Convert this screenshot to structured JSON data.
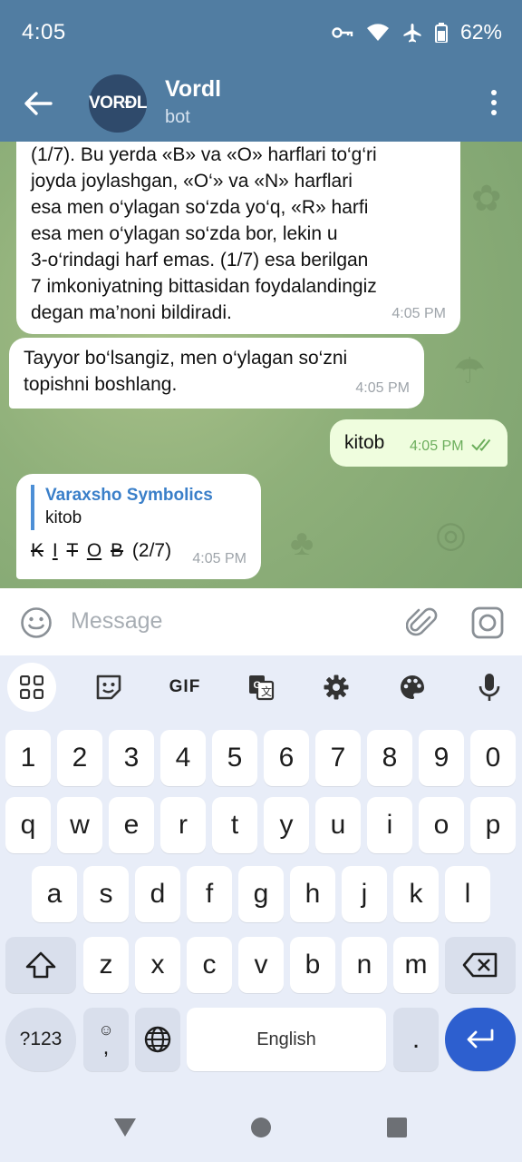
{
  "status_bar": {
    "time": "4:05",
    "battery": "62%"
  },
  "header": {
    "avatar_text": "VORÐL",
    "title": "Vordl",
    "subtitle": "bot"
  },
  "messages": {
    "m1": {
      "lines": [
        "(1/7). Bu yerda «B» va «O» harflari to‘g‘ri",
        "joyda joylashgan, «O‘» va «N» harflari",
        "esa men o‘ylagan so‘zda yo‘q, «R» harfi",
        "esa men o‘ylagan so‘zda bor, lekin u",
        "3-o‘rindagi harf emas. (1/7) esa berilgan",
        "7 imkoniyatning bittasidan foydalandingiz",
        "degan ma’noni bildiradi."
      ],
      "time": "4:05 PM"
    },
    "m2": {
      "lines": [
        "Tayyor bo‘lsangiz, men o‘ylagan so‘zni",
        "topishni boshlang."
      ],
      "time": "4:05 PM"
    },
    "m3": {
      "text": "kitob",
      "time": "4:05 PM"
    },
    "m4": {
      "reply_name": "Varaxsho Symbolics",
      "reply_text": "kitob",
      "letters": [
        "K",
        "I",
        "T",
        "O",
        "B"
      ],
      "count": "(2/7)",
      "time": "4:05 PM"
    }
  },
  "input": {
    "placeholder": "Message"
  },
  "keyboard": {
    "row_numbers": [
      "1",
      "2",
      "3",
      "4",
      "5",
      "6",
      "7",
      "8",
      "9",
      "0"
    ],
    "row1": [
      "q",
      "w",
      "e",
      "r",
      "t",
      "y",
      "u",
      "i",
      "o",
      "p"
    ],
    "row2": [
      "a",
      "s",
      "d",
      "f",
      "g",
      "h",
      "j",
      "k",
      "l"
    ],
    "row3": [
      "z",
      "x",
      "c",
      "v",
      "b",
      "n",
      "m"
    ],
    "symbols_key": "?123",
    "emoji_comma": ",",
    "space_label": "English",
    "period": ".",
    "gif": "GIF"
  },
  "colors": {
    "header": "#517da2",
    "outgoing": "#effdde",
    "accent": "#2d5fcf",
    "link": "#3a7fc9"
  }
}
